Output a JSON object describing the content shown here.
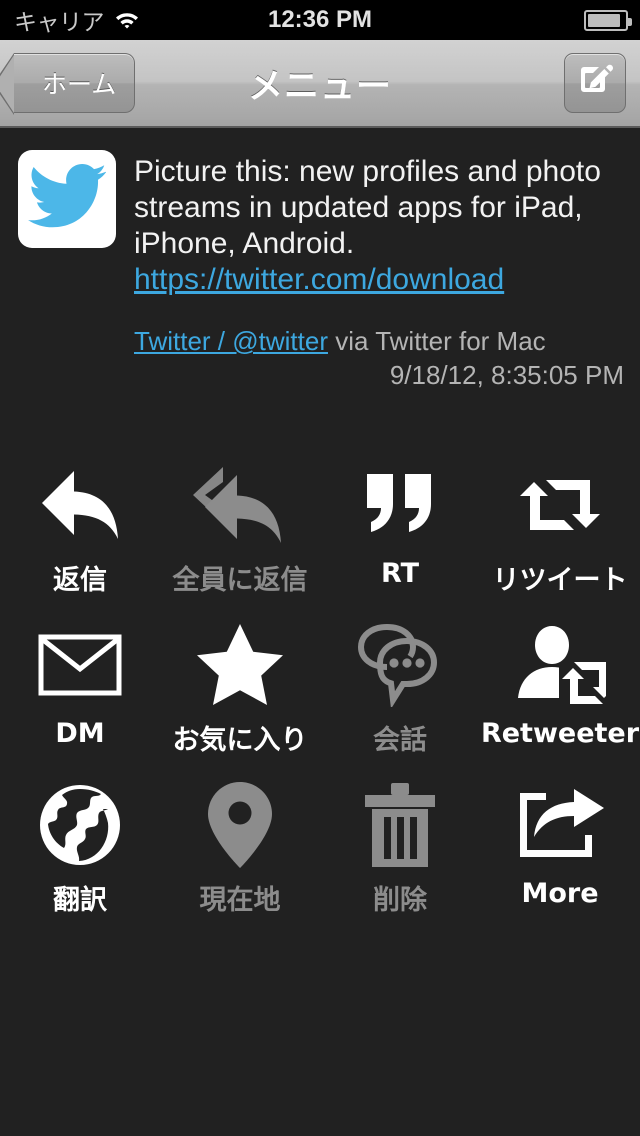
{
  "status_bar": {
    "carrier": "キャリア",
    "wifi_icon": "wifi-icon",
    "time": "12:36 PM",
    "battery_icon": "battery-icon"
  },
  "nav_bar": {
    "back_label": "ホーム",
    "title": "メニュー",
    "compose_icon": "compose-icon"
  },
  "tweet": {
    "avatar_icon": "twitter-bird-avatar",
    "text": "Picture this: new profiles and photo streams in updated apps for iPad, iPhone, Android. ",
    "url": "https://twitter.com/download",
    "author": "Twitter / @twitter",
    "via": " via Twitter for Mac",
    "date": "9/18/12, 8:35:05 PM"
  },
  "actions": [
    {
      "label": "返信",
      "icon": "reply-icon",
      "enabled": true
    },
    {
      "label": "全員に返信",
      "icon": "reply-all-icon",
      "enabled": false
    },
    {
      "label": "RT",
      "icon": "quote-icon",
      "enabled": true
    },
    {
      "label": "リツイート",
      "icon": "retweet-icon",
      "enabled": true
    },
    {
      "label": "DM",
      "icon": "envelope-icon",
      "enabled": true
    },
    {
      "label": "お気に入り",
      "icon": "star-icon",
      "enabled": true
    },
    {
      "label": "会話",
      "icon": "conversation-icon",
      "enabled": false
    },
    {
      "label": "Retweeter",
      "icon": "retweeter-icon",
      "enabled": true
    },
    {
      "label": "翻訳",
      "icon": "globe-icon",
      "enabled": true
    },
    {
      "label": "現在地",
      "icon": "map-pin-icon",
      "enabled": false
    },
    {
      "label": "削除",
      "icon": "trash-icon",
      "enabled": false
    },
    {
      "label": "More",
      "icon": "share-icon",
      "enabled": true
    }
  ],
  "colors": {
    "background": "#212121",
    "link": "#3da8e0",
    "twitter_blue": "#4cb7e8",
    "disabled": "#8c8c8c"
  }
}
